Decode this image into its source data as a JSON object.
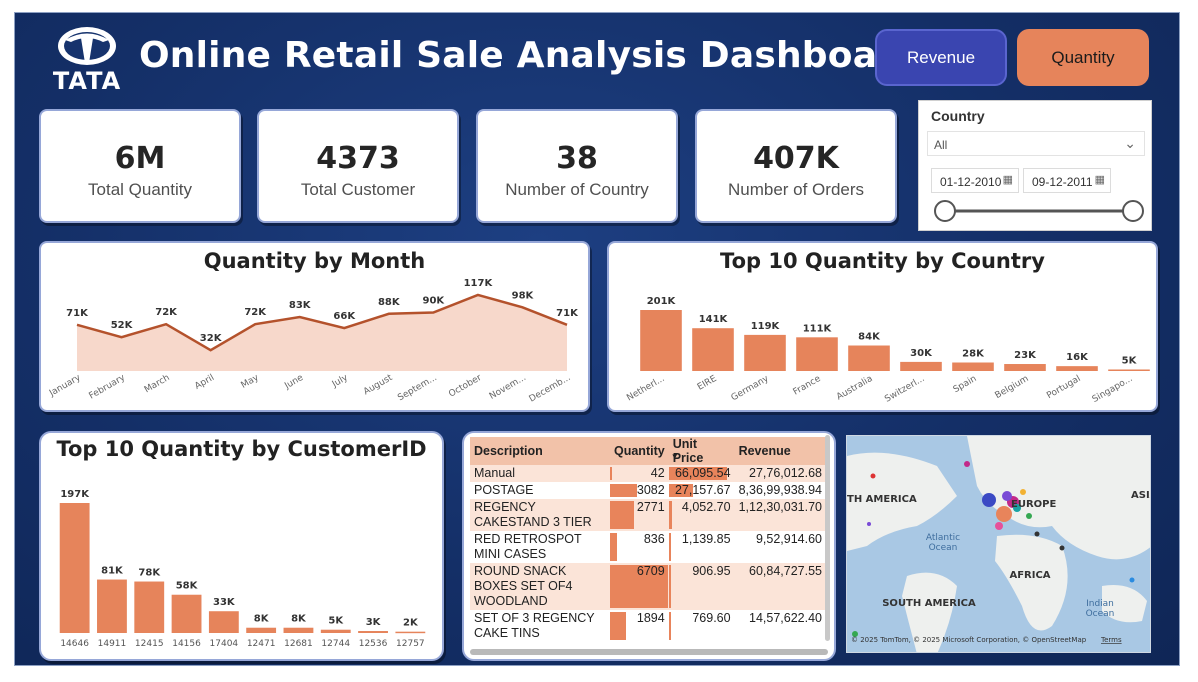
{
  "header": {
    "logo_text": "TATA",
    "title": "Online Retail Sale Analysis Dashboard",
    "buttons": {
      "revenue": "Revenue",
      "quantity": "Quantity"
    }
  },
  "colors": {
    "background": "#142f67",
    "accent_orange": "#e6845b",
    "accent_blue": "#3a45b0",
    "area_fill": "#f7d8cb",
    "line": "#b4522c"
  },
  "kpis": [
    {
      "value": "6M",
      "label": "Total Quantity"
    },
    {
      "value": "4373",
      "label": "Total Customer"
    },
    {
      "value": "38",
      "label": "Number of Country"
    },
    {
      "value": "407K",
      "label": "Number of Orders"
    }
  ],
  "filter": {
    "label": "Country",
    "selected": "All",
    "date_start": "01-12-2010",
    "date_end": "09-12-2011",
    "range_selected": [
      0,
      1
    ]
  },
  "chart_data": [
    {
      "type": "area",
      "title": "Quantity by Month",
      "categories": [
        "January",
        "February",
        "March",
        "April",
        "May",
        "June",
        "July",
        "August",
        "Septem...",
        "October",
        "Novem...",
        "Decemb..."
      ],
      "values": [
        71,
        52,
        72,
        32,
        72,
        83,
        66,
        88,
        90,
        117,
        98,
        71
      ],
      "data_labels": [
        "71K",
        "52K",
        "72K",
        "32K",
        "72K",
        "83K",
        "66K",
        "88K",
        "90K",
        "117K",
        "98K",
        "71K"
      ],
      "unit": "K"
    },
    {
      "type": "bar",
      "title": "Top 10 Quantity by Country",
      "categories": [
        "Netherl...",
        "EIRE",
        "Germany",
        "France",
        "Australia",
        "Switzerl...",
        "Spain",
        "Belgium",
        "Portugal",
        "Singapo..."
      ],
      "values": [
        201,
        141,
        119,
        111,
        84,
        30,
        28,
        23,
        16,
        5
      ],
      "data_labels": [
        "201K",
        "141K",
        "119K",
        "111K",
        "84K",
        "30K",
        "28K",
        "23K",
        "16K",
        "5K"
      ],
      "unit": "K"
    },
    {
      "type": "bar",
      "title": "Top 10 Quantity by CustomerID",
      "categories": [
        "14646",
        "14911",
        "12415",
        "14156",
        "17404",
        "12471",
        "12681",
        "12744",
        "12536",
        "12757"
      ],
      "values": [
        197,
        81,
        78,
        58,
        33,
        8,
        8,
        5,
        3,
        2
      ],
      "data_labels": [
        "197K",
        "81K",
        "78K",
        "58K",
        "33K",
        "8K",
        "8K",
        "5K",
        "3K",
        "2K"
      ],
      "unit": "K"
    },
    {
      "type": "table",
      "columns": [
        "Description",
        "Quantity",
        "Unit Price",
        "Revenue"
      ],
      "rows": [
        {
          "description": "Manual",
          "quantity": "42",
          "unit_price": "66,095.54",
          "revenue": "27,76,012.68",
          "q": 42,
          "u": 66095.54
        },
        {
          "description": "POSTAGE",
          "quantity": "3082",
          "unit_price": "27,157.67",
          "revenue": "8,36,99,938.94",
          "q": 3082,
          "u": 27157.67
        },
        {
          "description": "REGENCY CAKESTAND 3 TIER",
          "quantity": "2771",
          "unit_price": "4,052.70",
          "revenue": "1,12,30,031.70",
          "q": 2771,
          "u": 4052.7
        },
        {
          "description": "RED RETROSPOT MINI CASES",
          "quantity": "836",
          "unit_price": "1,139.85",
          "revenue": "9,52,914.60",
          "q": 836,
          "u": 1139.85
        },
        {
          "description": "ROUND SNACK BOXES SET OF4 WOODLAND",
          "quantity": "6709",
          "unit_price": "906.95",
          "revenue": "60,84,727.55",
          "q": 6709,
          "u": 906.95
        },
        {
          "description": "SET OF 3 REGENCY CAKE TINS",
          "quantity": "1894",
          "unit_price": "769.60",
          "revenue": "14,57,622.40",
          "q": 1894,
          "u": 769.6
        }
      ]
    }
  ],
  "map": {
    "labels": {
      "north_america": "TH AMERICA",
      "europe": "EUROPE",
      "asia": "ASIA",
      "atlantic": "Atlantic",
      "ocean": "Ocean",
      "africa": "AFRICA",
      "south_america": "SOUTH AMERICA",
      "indian": "Indian",
      "indian_ocean": "Ocean"
    },
    "attribution": "© 2025 TomTom, © 2025 Microsoft Corporation, © OpenStreetMap",
    "terms": "Terms"
  }
}
